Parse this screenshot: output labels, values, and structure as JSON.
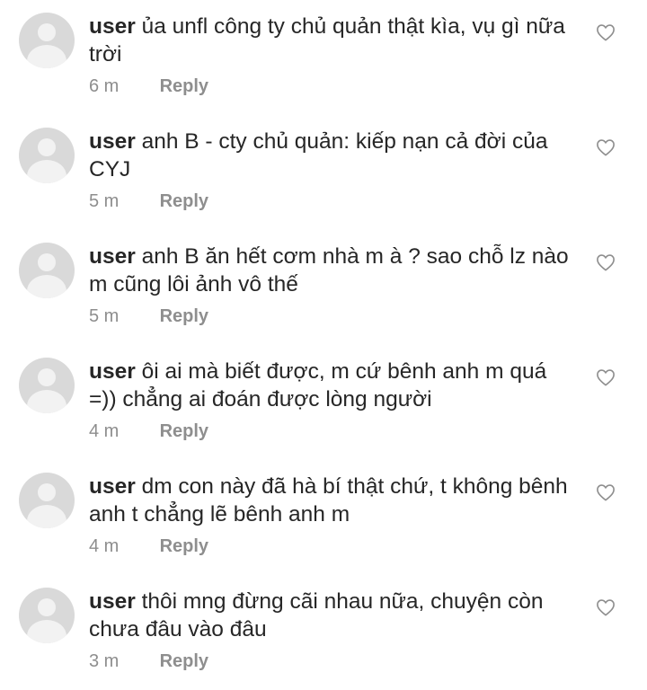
{
  "comments": [
    {
      "username": "user",
      "text": "ủa unfl công ty chủ quản thật kìa, vụ gì nữa trời",
      "time": "6 m",
      "reply_label": "Reply",
      "like_icon": "heart-outline-icon"
    },
    {
      "username": "user",
      "text": "anh B - cty chủ quản: kiếp nạn cả đời của CYJ",
      "time": "5 m",
      "reply_label": "Reply",
      "like_icon": "heart-outline-icon"
    },
    {
      "username": "user",
      "text": "anh B ăn hết cơm nhà m à ? sao chỗ lz nào m cũng lôi ảnh vô thế",
      "time": "5 m",
      "reply_label": "Reply",
      "like_icon": "heart-outline-icon"
    },
    {
      "username": "user",
      "text": "ôi ai mà biết được, m cứ bênh anh m quá =)) chẳng ai đoán được lòng người",
      "time": "4 m",
      "reply_label": "Reply",
      "like_icon": "heart-outline-icon"
    },
    {
      "username": "user",
      "text": "dm con này đã hà bí thật chứ, t không bênh anh t chẳng lẽ bênh anh m",
      "time": "4 m",
      "reply_label": "Reply",
      "like_icon": "heart-outline-icon"
    },
    {
      "username": "user",
      "text": "thôi mng đừng cãi nhau nữa, chuyện còn chưa đâu vào đâu",
      "time": "3 m",
      "reply_label": "Reply",
      "like_icon": "heart-outline-icon"
    }
  ],
  "colors": {
    "text": "#262626",
    "meta": "#8e8e8e",
    "avatar_bg": "#d9d9d9",
    "avatar_fg": "#f2f2f2",
    "heart_stroke": "#8e8e8e"
  }
}
